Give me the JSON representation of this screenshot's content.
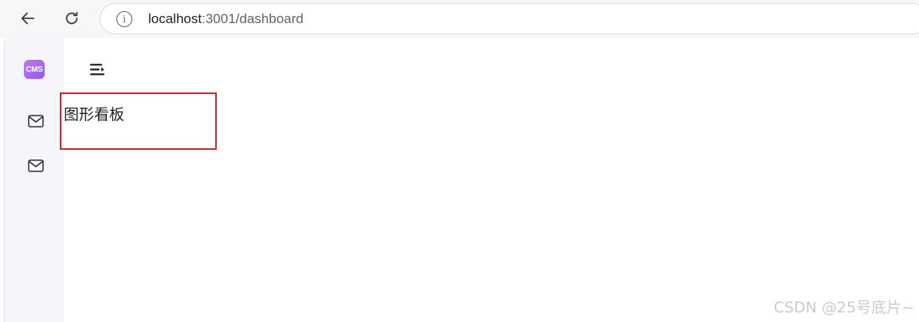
{
  "browser": {
    "url_host": "localhost",
    "url_path": ":3001/dashboard"
  },
  "sidebar": {
    "logo_text": "CMS",
    "items": [
      {
        "icon": "mail-icon"
      },
      {
        "icon": "mail-icon"
      }
    ]
  },
  "main": {
    "page_title": "图形看板"
  },
  "watermark": "CSDN @25号底片~",
  "colors": {
    "sidebar_bg": "#f5f6fa",
    "logo_gradient_start": "#c673f5",
    "logo_gradient_end": "#8c5cf2",
    "highlight_border": "#d7262b"
  }
}
